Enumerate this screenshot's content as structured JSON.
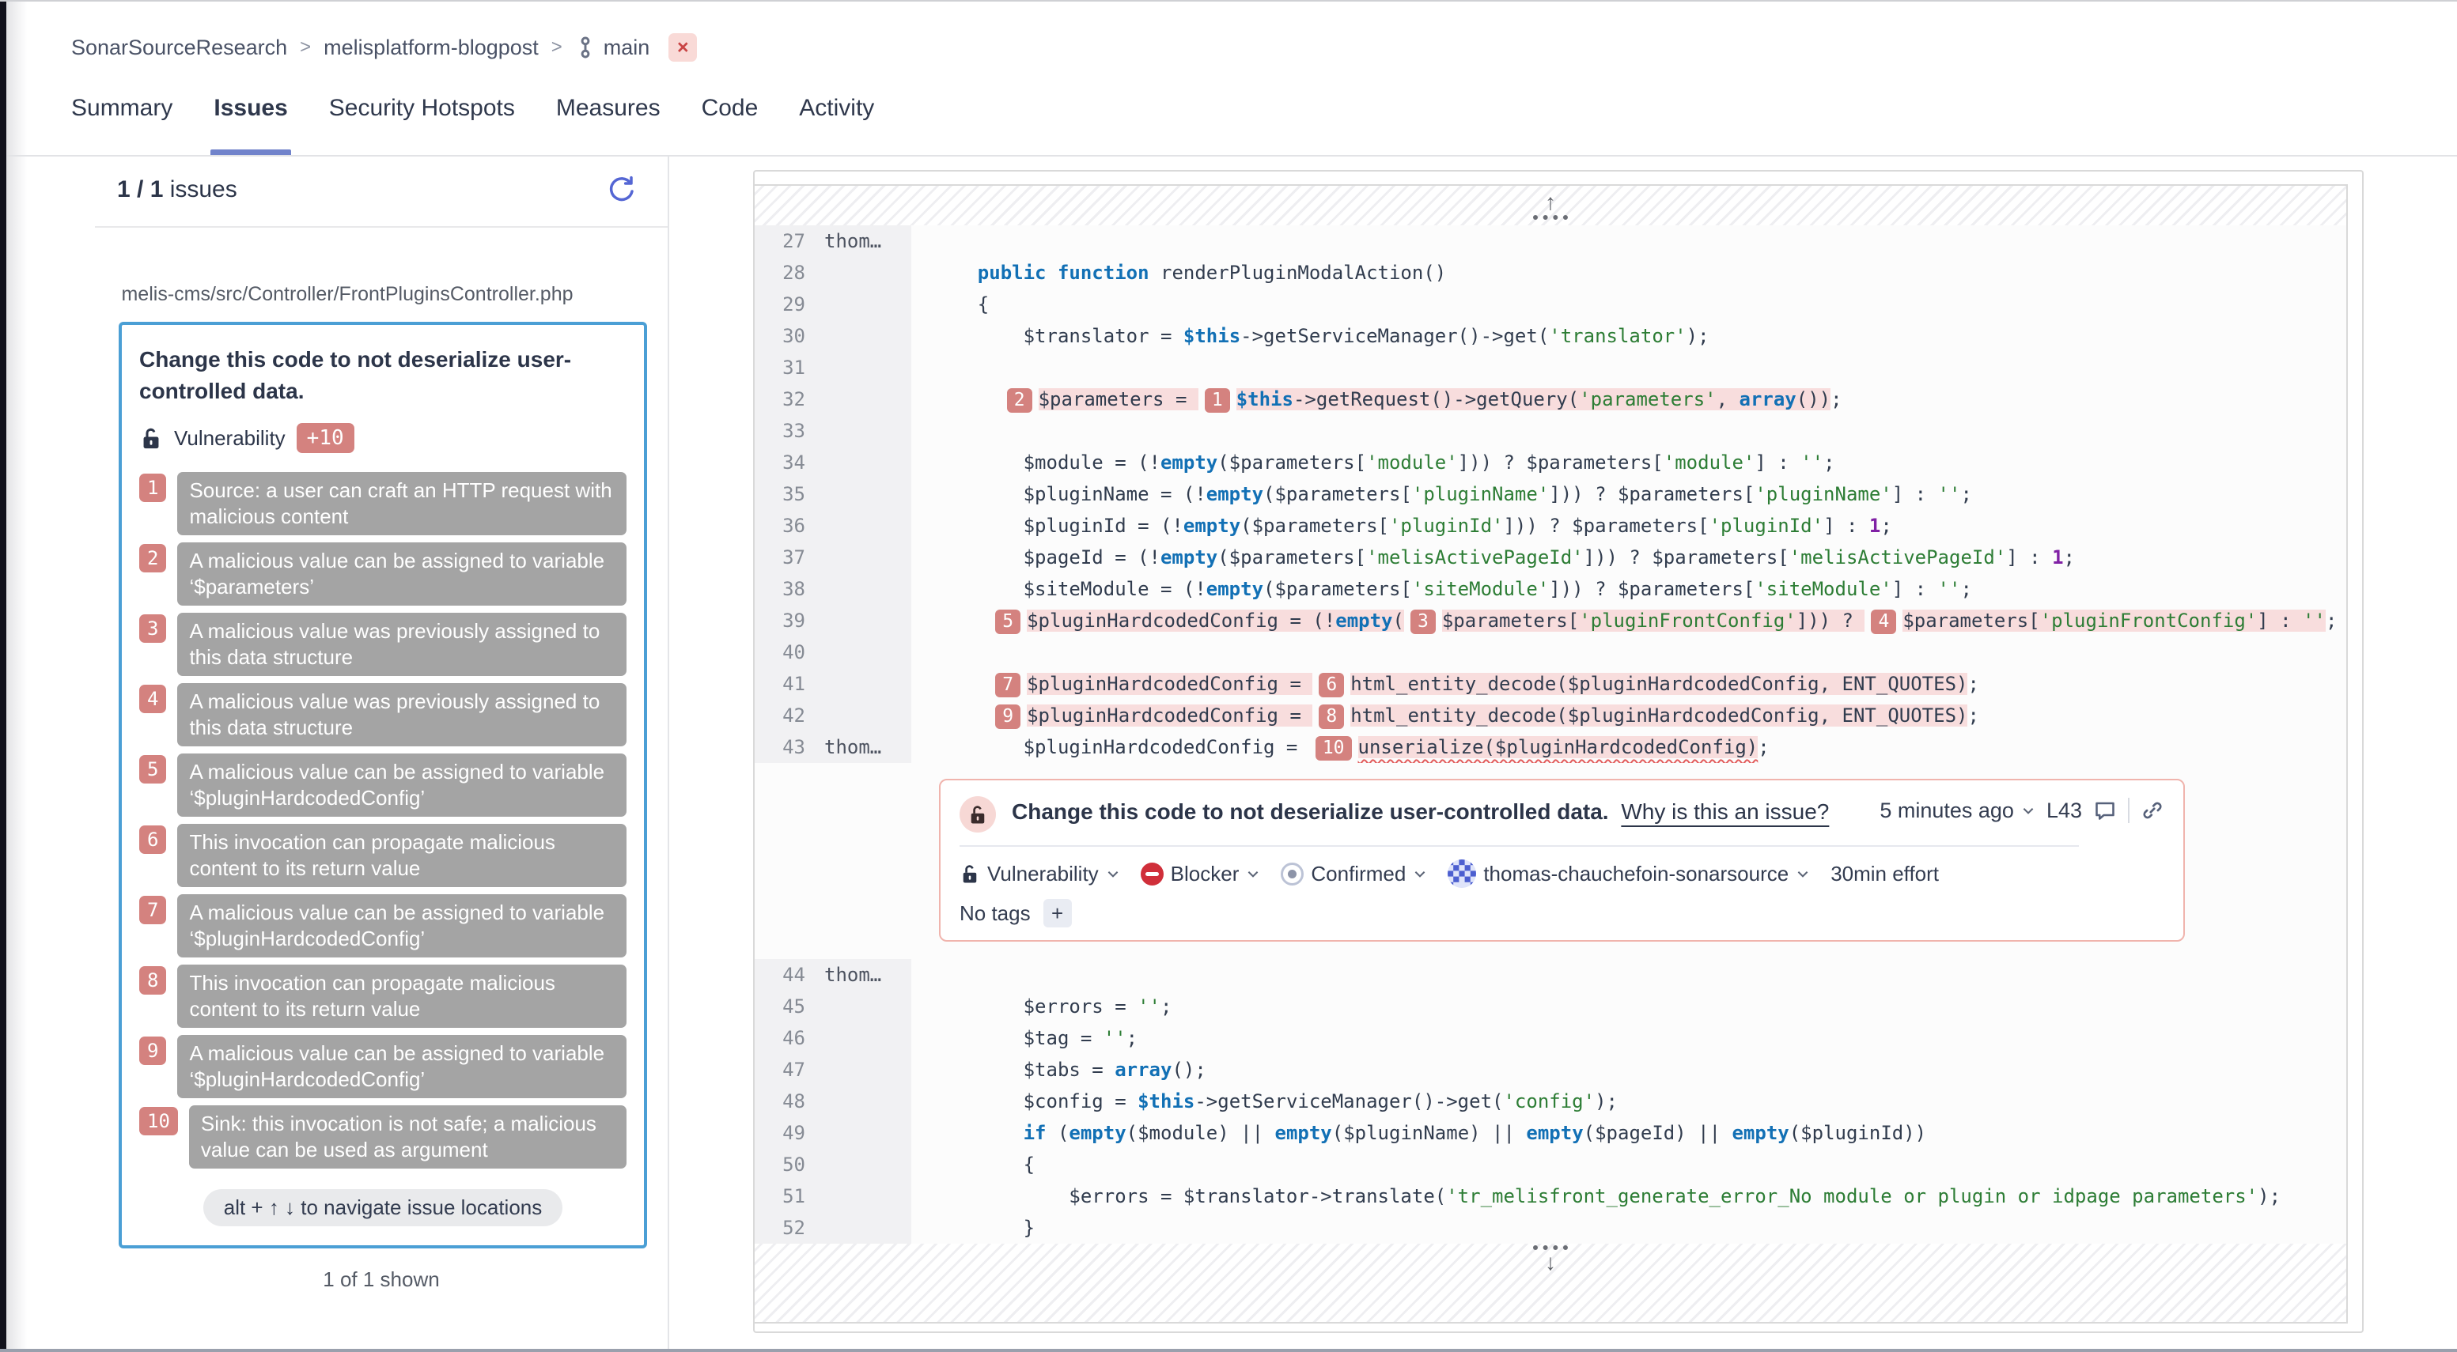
{
  "colors": {
    "selected_issue_border": "#4b9fd5",
    "location_badge": "#d4827f",
    "flow_box": "#a4a4a4",
    "issue_box_border": "#f0b4ad",
    "blocker_red": "#d02f3a",
    "tab_underline": "#7183cb",
    "keyword_blue": "#1270b5",
    "string_green": "#2d7d35",
    "constant_purple": "#8021a5",
    "line_highlight": "#f8dddd"
  },
  "icons": {
    "close": "×",
    "arrow_up": "↑",
    "arrow_down": "↓",
    "plus": "+"
  },
  "breadcrumb": {
    "org": "SonarSourceResearch",
    "sep": ">",
    "project": "melisplatform-blogpost",
    "branch": "main"
  },
  "tabs": {
    "items": [
      {
        "label": "Summary",
        "active": false
      },
      {
        "label": "Issues",
        "active": true
      },
      {
        "label": "Security Hotspots",
        "active": false
      },
      {
        "label": "Measures",
        "active": false
      },
      {
        "label": "Code",
        "active": false
      },
      {
        "label": "Activity",
        "active": false
      }
    ]
  },
  "issues_panel": {
    "count": "1 / 1",
    "count_suffix": " issues",
    "file_path": "melis-cms/src/Controller/FrontPluginsController.php",
    "issue_card": {
      "title": "Change this code to not deserialize user-controlled data.",
      "type": "Vulnerability",
      "locations_badge": "+10",
      "flows": [
        {
          "num": "1",
          "text": "Source: a user can craft an HTTP request with malicious content"
        },
        {
          "num": "2",
          "text": "A malicious value can be assigned to variable ‘$parameters’"
        },
        {
          "num": "3",
          "text": "A malicious value was previously assigned to this data structure"
        },
        {
          "num": "4",
          "text": "A malicious value was previously assigned to this data structure"
        },
        {
          "num": "5",
          "text": "A malicious value can be assigned to variable ‘$pluginHardcodedConfig’"
        },
        {
          "num": "6",
          "text": "This invocation can propagate malicious content to its return value"
        },
        {
          "num": "7",
          "text": "A malicious value can be assigned to variable ‘$pluginHardcodedConfig’"
        },
        {
          "num": "8",
          "text": "This invocation can propagate malicious content to its return value"
        },
        {
          "num": "9",
          "text": "A malicious value can be assigned to variable ‘$pluginHardcodedConfig’"
        },
        {
          "num": "10",
          "text": "Sink: this invocation is not safe; a malicious value can be used as argument"
        }
      ],
      "shortcut_hint": "alt + ↑ ↓ to navigate issue locations"
    },
    "footer": "1 of 1 shown"
  },
  "code_panel": {
    "lines_top": [
      {
        "n": "27",
        "a": "thom…",
        "p": []
      },
      {
        "n": "28",
        "p": [
          {
            "t": "    "
          },
          {
            "t": "public function",
            "c": "k"
          },
          {
            "t": " renderPluginModalAction()"
          }
        ]
      },
      {
        "n": "29",
        "p": [
          {
            "t": "    {"
          }
        ]
      },
      {
        "n": "30",
        "p": [
          {
            "t": "        $translator = "
          },
          {
            "t": "$this",
            "c": "k"
          },
          {
            "t": "->getServiceManager()->get("
          },
          {
            "t": "'translator'",
            "c": "s"
          },
          {
            "t": ");"
          }
        ]
      },
      {
        "n": "31",
        "p": []
      },
      {
        "n": "32",
        "p": [
          {
            "t": "      "
          },
          {
            "b": "2"
          },
          {
            "t": "$parameters = ",
            "h": 1
          },
          {
            "b": "1"
          },
          {
            "t": "$this",
            "c": "k",
            "h": 1
          },
          {
            "t": "->getRequest()->getQuery(",
            "h": 1
          },
          {
            "t": "'parameters'",
            "c": "s",
            "h": 1
          },
          {
            "t": ", ",
            "h": 1
          },
          {
            "t": "array",
            "c": "k",
            "h": 1
          },
          {
            "t": "())",
            "h": 1
          },
          {
            "t": ";"
          }
        ]
      },
      {
        "n": "33",
        "p": []
      },
      {
        "n": "34",
        "p": [
          {
            "t": "        $module = (!"
          },
          {
            "t": "empty",
            "c": "k"
          },
          {
            "t": "($parameters["
          },
          {
            "t": "'module'",
            "c": "s"
          },
          {
            "t": "])) ? $parameters["
          },
          {
            "t": "'module'",
            "c": "s"
          },
          {
            "t": "] : "
          },
          {
            "t": "''",
            "c": "s"
          },
          {
            "t": ";"
          }
        ]
      },
      {
        "n": "35",
        "p": [
          {
            "t": "        $pluginName = (!"
          },
          {
            "t": "empty",
            "c": "k"
          },
          {
            "t": "($parameters["
          },
          {
            "t": "'pluginName'",
            "c": "s"
          },
          {
            "t": "])) ? $parameters["
          },
          {
            "t": "'pluginName'",
            "c": "s"
          },
          {
            "t": "] : "
          },
          {
            "t": "''",
            "c": "s"
          },
          {
            "t": ";"
          }
        ]
      },
      {
        "n": "36",
        "p": [
          {
            "t": "        $pluginId = (!"
          },
          {
            "t": "empty",
            "c": "k"
          },
          {
            "t": "($parameters["
          },
          {
            "t": "'pluginId'",
            "c": "s"
          },
          {
            "t": "])) ? $parameters["
          },
          {
            "t": "'pluginId'",
            "c": "s"
          },
          {
            "t": "] : "
          },
          {
            "t": "1",
            "c": "n"
          },
          {
            "t": ";"
          }
        ]
      },
      {
        "n": "37",
        "p": [
          {
            "t": "        $pageId = (!"
          },
          {
            "t": "empty",
            "c": "k"
          },
          {
            "t": "($parameters["
          },
          {
            "t": "'melisActivePageId'",
            "c": "s"
          },
          {
            "t": "])) ? $parameters["
          },
          {
            "t": "'melisActivePageId'",
            "c": "s"
          },
          {
            "t": "] : "
          },
          {
            "t": "1",
            "c": "n"
          },
          {
            "t": ";"
          }
        ]
      },
      {
        "n": "38",
        "p": [
          {
            "t": "        $siteModule = (!"
          },
          {
            "t": "empty",
            "c": "k"
          },
          {
            "t": "($parameters["
          },
          {
            "t": "'siteModule'",
            "c": "s"
          },
          {
            "t": "])) ? $parameters["
          },
          {
            "t": "'siteModule'",
            "c": "s"
          },
          {
            "t": "] : "
          },
          {
            "t": "''",
            "c": "s"
          },
          {
            "t": ";"
          }
        ]
      },
      {
        "n": "39",
        "p": [
          {
            "t": "     "
          },
          {
            "b": "5"
          },
          {
            "t": "$pluginHardcodedConfig = (!",
            "h": 1
          },
          {
            "t": "empty",
            "c": "k",
            "h": 1
          },
          {
            "t": "(",
            "h": 1
          },
          {
            "b": "3"
          },
          {
            "t": "$parameters[",
            "h": 1
          },
          {
            "t": "'pluginFrontConfig'",
            "c": "s",
            "h": 1
          },
          {
            "t": "])) ? ",
            "h": 1
          },
          {
            "b": "4"
          },
          {
            "t": "$parameters[",
            "h": 1
          },
          {
            "t": "'pluginFrontConfig'",
            "c": "s",
            "h": 1
          },
          {
            "t": "] : ",
            "h": 1
          },
          {
            "t": "''",
            "c": "s",
            "h": 1
          },
          {
            "t": ";"
          }
        ]
      },
      {
        "n": "40",
        "p": []
      },
      {
        "n": "41",
        "p": [
          {
            "t": "     "
          },
          {
            "b": "7"
          },
          {
            "t": "$pluginHardcodedConfig = ",
            "h": 1
          },
          {
            "b": "6"
          },
          {
            "t": "html_entity_decode($pluginHardcodedConfig, ENT_QUOTES)",
            "h": 1
          },
          {
            "t": ";"
          }
        ]
      },
      {
        "n": "42",
        "p": [
          {
            "t": "     "
          },
          {
            "b": "9"
          },
          {
            "t": "$pluginHardcodedConfig = ",
            "h": 1
          },
          {
            "b": "8"
          },
          {
            "t": "html_entity_decode($pluginHardcodedConfig, ENT_QUOTES)",
            "h": 1
          },
          {
            "t": ";"
          }
        ]
      },
      {
        "n": "43",
        "a": "thom…",
        "p": [
          {
            "t": "        $pluginHardcodedConfig = "
          },
          {
            "b": "10"
          },
          {
            "t": "unserialize($pluginHardcodedConfig)",
            "h": 1,
            "w": 1
          },
          {
            "t": ";"
          }
        ]
      }
    ],
    "lines_bottom": [
      {
        "n": "44",
        "a": "thom…",
        "p": []
      },
      {
        "n": "45",
        "p": [
          {
            "t": "        $errors = "
          },
          {
            "t": "''",
            "c": "s"
          },
          {
            "t": ";"
          }
        ]
      },
      {
        "n": "46",
        "p": [
          {
            "t": "        $tag = "
          },
          {
            "t": "''",
            "c": "s"
          },
          {
            "t": ";"
          }
        ]
      },
      {
        "n": "47",
        "p": [
          {
            "t": "        $tabs = "
          },
          {
            "t": "array",
            "c": "k"
          },
          {
            "t": "();"
          }
        ]
      },
      {
        "n": "48",
        "p": [
          {
            "t": "        $config = "
          },
          {
            "t": "$this",
            "c": "k"
          },
          {
            "t": "->getServiceManager()->get("
          },
          {
            "t": "'config'",
            "c": "s"
          },
          {
            "t": ");"
          }
        ]
      },
      {
        "n": "49",
        "p": [
          {
            "t": "        "
          },
          {
            "t": "if",
            "c": "k"
          },
          {
            "t": " ("
          },
          {
            "t": "empty",
            "c": "k"
          },
          {
            "t": "($module) || "
          },
          {
            "t": "empty",
            "c": "k"
          },
          {
            "t": "($pluginName) || "
          },
          {
            "t": "empty",
            "c": "k"
          },
          {
            "t": "($pageId) || "
          },
          {
            "t": "empty",
            "c": "k"
          },
          {
            "t": "($pluginId))"
          }
        ]
      },
      {
        "n": "50",
        "p": [
          {
            "t": "        {"
          }
        ]
      },
      {
        "n": "51",
        "p": [
          {
            "t": "            $errors = $translator->translate("
          },
          {
            "t": "'tr_melisfront_generate_error_No module or plugin or idpage parameters'",
            "c": "s"
          },
          {
            "t": ");"
          }
        ]
      },
      {
        "n": "52",
        "p": [
          {
            "t": "        }"
          }
        ]
      }
    ],
    "issue_box": {
      "title": "Change this code to not deserialize user-controlled data.",
      "why_link": "Why is this an issue?",
      "age": "5 minutes ago",
      "line_ref": "L43",
      "type": "Vulnerability",
      "severity": "Blocker",
      "status": "Confirmed",
      "assignee": "thomas-chauchefoin-sonarsource",
      "effort": "30min effort",
      "tags_label": "No tags"
    }
  }
}
